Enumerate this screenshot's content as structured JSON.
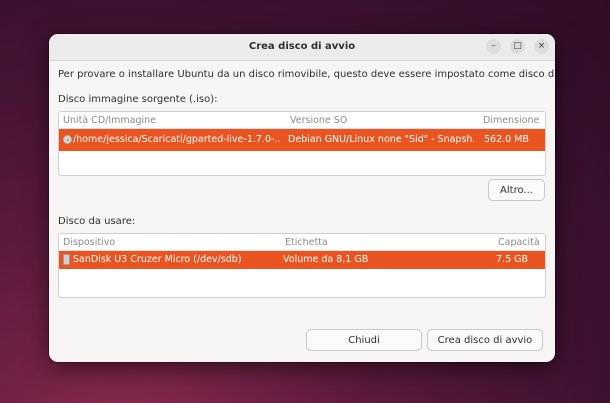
{
  "window": {
    "title": "Crea disco di avvio",
    "intro_text": "Per provare o installare Ubuntu da un disco rimovibile, questo deve essere impostato come disco di avvio.",
    "controls": {
      "minimize": "–",
      "maximize": "□",
      "close": "×"
    }
  },
  "source": {
    "label": "Disco immagine sorgente (.iso):",
    "columns": [
      "Unità CD/Immagine",
      "Versione SO",
      "Dimensione"
    ],
    "rows": [
      {
        "path": "/home/jessica/Scaricati/gparted-live-1.7.0-...",
        "version": "Debian GNU/Linux none \"Sid\" - Snapsh...",
        "size": "562.0 MB"
      }
    ],
    "other_button": "Altro..."
  },
  "target": {
    "label": "Disco da usare:",
    "columns": [
      "Dispositivo",
      "Etichetta",
      "Capacità"
    ],
    "rows": [
      {
        "device": "SanDisk U3 Cruzer Micro (/dev/sdb)",
        "label": "Volume da 8,1 GB",
        "capacity": "7.5 GB"
      }
    ]
  },
  "buttons": {
    "close": "Chiudi",
    "create": "Crea disco di avvio"
  },
  "colors": {
    "selection": "#e95420",
    "window_bg": "#f6f5f4"
  }
}
